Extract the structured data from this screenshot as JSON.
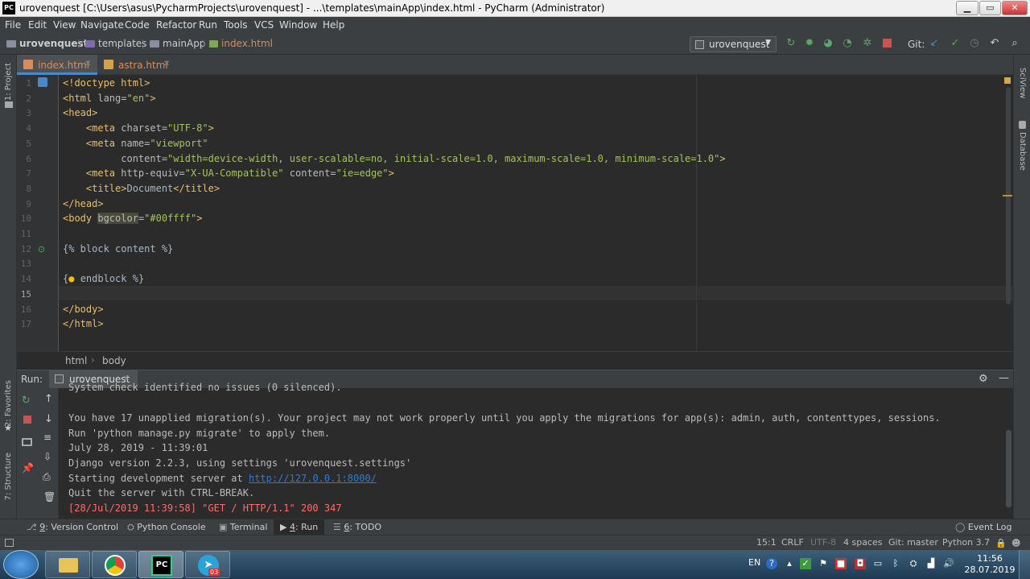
{
  "window": {
    "title": "urovenquest [C:\\Users\\asus\\PycharmProjects\\urovenquest] - ...\\templates\\mainApp\\index.html - PyCharm (Administrator)",
    "app_icon": "PC"
  },
  "menu": [
    "File",
    "Edit",
    "View",
    "Navigate",
    "Code",
    "Refactor",
    "Run",
    "Tools",
    "VCS",
    "Window",
    "Help"
  ],
  "breadcrumb": [
    "urovenquest",
    "templates",
    "mainApp",
    "index.html"
  ],
  "run_config": "urovenquest",
  "git_label": "Git:",
  "editor_tabs": [
    {
      "label": "index.html",
      "active": true
    },
    {
      "label": "astra.html",
      "active": false
    }
  ],
  "side_left": {
    "project": "1: Project",
    "favorites": "2: Favorites",
    "structure": "7: Structure"
  },
  "side_right": {
    "sciview": "SciView",
    "database": "Database"
  },
  "code_lines": [
    {
      "n": "1"
    },
    {
      "n": "2"
    },
    {
      "n": "3"
    },
    {
      "n": "4"
    },
    {
      "n": "5"
    },
    {
      "n": "6"
    },
    {
      "n": "7"
    },
    {
      "n": "8"
    },
    {
      "n": "9"
    },
    {
      "n": "10"
    },
    {
      "n": "11"
    },
    {
      "n": "12"
    },
    {
      "n": "13"
    },
    {
      "n": "14"
    },
    {
      "n": "15"
    },
    {
      "n": "16"
    },
    {
      "n": "17"
    }
  ],
  "code": {
    "l1": "<!doctype html>",
    "l2a": "<html ",
    "l2b": "lang=",
    "l2c": "\"en\"",
    "l2d": ">",
    "l3": "<head>",
    "l4a": "    <meta ",
    "l4b": "charset=",
    "l4c": "\"UTF-8\"",
    "l4d": ">",
    "l5a": "    <meta ",
    "l5b": "name=",
    "l5c": "\"viewport\"",
    "l6a": "          content=",
    "l6b": "\"width=device-width, user-scalable=no, initial-scale=1.0, maximum-scale=1.0, minimum-scale=1.0\"",
    "l6c": ">",
    "l7a": "    <meta ",
    "l7b": "http-equiv=",
    "l7c": "\"X-UA-Compatible\"",
    "l7d": " content=",
    "l7e": "\"ie=edge\"",
    "l7f": ">",
    "l8a": "    <title>",
    "l8b": "Document",
    "l8c": "</title>",
    "l9": "</head>",
    "l10a": "<body ",
    "l10b": "bgcolor",
    "l10c": "=",
    "l10d": "\"#00ffff\"",
    "l10e": ">",
    "l12": "{% block content %}",
    "l14a": "{",
    "l14b": " endblock %}",
    "l16": "</body>",
    "l17": "</html>"
  },
  "editor_breadcrumb": [
    "html",
    "body"
  ],
  "run_panel": {
    "label": "Run:",
    "tab": "urovenquest",
    "output": [
      {
        "text": "System check identified no issues (0 silenced).",
        "type": "normal"
      },
      {
        "text": "",
        "type": "normal"
      },
      {
        "text": "You have 17 unapplied migration(s). Your project may not work properly until you apply the migrations for app(s): admin, auth, contenttypes, sessions.",
        "type": "normal"
      },
      {
        "text": "Run 'python manage.py migrate' to apply them.",
        "type": "normal"
      },
      {
        "text": "July 28, 2019 - 11:39:01",
        "type": "normal"
      },
      {
        "text": "Django version 2.2.3, using settings 'urovenquest.settings'",
        "type": "normal"
      },
      {
        "text": "Starting development server at ",
        "link": "http://127.0.0.1:8000/",
        "type": "link"
      },
      {
        "text": "Quit the server with CTRL-BREAK.",
        "type": "normal"
      },
      {
        "text": "[28/Jul/2019 11:39:58] \"GET / HTTP/1.1\" 200 347",
        "type": "error"
      }
    ]
  },
  "bottom_tabs": [
    {
      "key": "9",
      "label": ": Version Control"
    },
    {
      "key": "",
      "label": "Python Console"
    },
    {
      "key": "",
      "label": "Terminal"
    },
    {
      "key": "4",
      "label": ": Run"
    },
    {
      "key": "6",
      "label": ": TODO"
    }
  ],
  "event_log": "Event Log",
  "status": {
    "position": "15:1",
    "line_sep": "CRLF",
    "encoding": "UTF-8",
    "indent": "4 spaces",
    "git": "Git: master",
    "interpreter": "Python 3.7"
  },
  "taskbar": {
    "lang": "EN",
    "time": "11:56",
    "date": "28.07.2019",
    "telegram_badge": "03"
  },
  "colors": {
    "accent_link": "#287bde",
    "error_text": "#ff6b68",
    "tag": "#e8bf6a",
    "string": "#a5c25c"
  }
}
